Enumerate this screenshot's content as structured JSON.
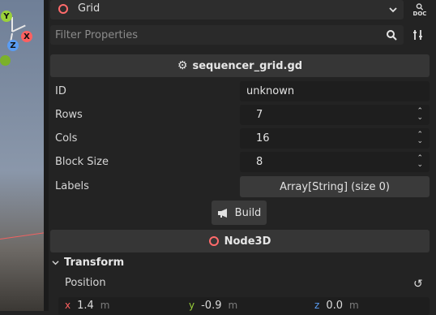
{
  "viewport": {
    "gizmo": {
      "y_label": "Y",
      "x_label": "X",
      "z_label": "Z"
    }
  },
  "inspector": {
    "node_select": {
      "label": "Grid"
    },
    "doc_button": {
      "label": "DOC"
    },
    "filter": {
      "placeholder": "Filter Properties"
    },
    "script_section": {
      "title": "sequencer_grid.gd"
    },
    "properties": [
      {
        "label": "ID",
        "value": "unknown",
        "kind": "text"
      },
      {
        "label": "Rows",
        "value": "7",
        "kind": "spin"
      },
      {
        "label": "Cols",
        "value": "16",
        "kind": "spin"
      },
      {
        "label": "Block Size",
        "value": "8",
        "kind": "spin"
      },
      {
        "label": "Labels",
        "value": "Array[String] (size 0)",
        "kind": "array"
      }
    ],
    "build_button": {
      "label": "Build"
    },
    "node3d_section": {
      "title": "Node3D"
    },
    "transform": {
      "title": "Transform",
      "position": {
        "label": "Position",
        "x": {
          "axis": "x",
          "value": "1.4",
          "unit": "m"
        },
        "y": {
          "axis": "y",
          "value": "-0.9",
          "unit": "m"
        },
        "z": {
          "axis": "z",
          "value": "0.0",
          "unit": "m"
        }
      }
    }
  },
  "colors": {
    "panel_bg": "#232323",
    "header_bg": "#363636",
    "field_bg": "#1e1e1e",
    "node_icon": "#ff6b6b",
    "axis_x": "#ff6060",
    "axis_y": "#9ad13a",
    "axis_z": "#5a9cf2"
  }
}
